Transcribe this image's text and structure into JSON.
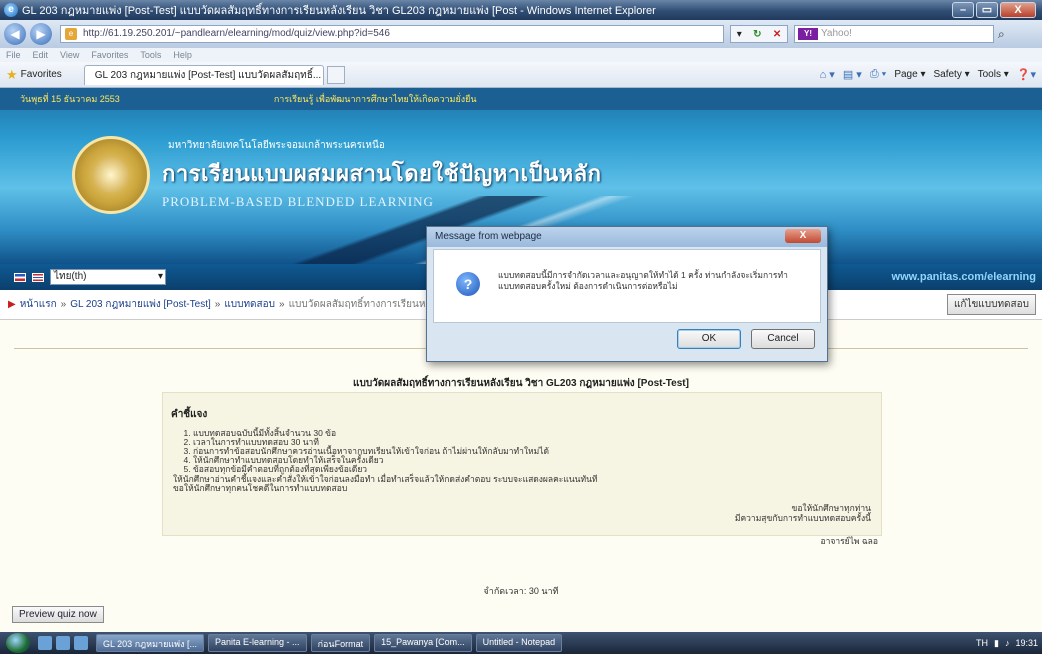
{
  "window": {
    "title": "GL 203 กฎหมายแพ่ง [Post-Test] แบบวัดผลสัมฤทธิ์ทางการเรียนหลังเรียน วิชา GL203 กฎหมายแพ่ง [Post - Windows Internet Explorer",
    "controls": [
      "–",
      "▭",
      "X"
    ]
  },
  "address": {
    "url": "http://61.19.250.201/~pandlearn/elearning/mod/quiz/view.php?id=546",
    "search_placeholder": "Yahoo!"
  },
  "menu": [
    "File",
    "Edit",
    "View",
    "Favorites",
    "Tools",
    "Help"
  ],
  "favorites": {
    "label": "Favorites",
    "tab_title": "GL 203 กฎหมายแพ่ง [Post-Test] แบบวัดผลสัมฤทธิ์...",
    "commands": [
      "Page ▾",
      "Safety ▾",
      "Tools ▾"
    ]
  },
  "banner": {
    "date": "วันพุธที่ 15 ธันวาคม 2553",
    "headline": "การเรียนรู้ เพื่อพัฒนาการศึกษาไทยให้เกิดความยั่งยืน",
    "university": "มหาวิทยาลัยเทคโนโลยีพระจอมเกล้าพระนครเหนือ",
    "thai_title": "การเรียนแบบผสมผสานโดยใช้ปัญหาเป็นหลัก",
    "eng_title": "PROBLEM-BASED BLENDED LEARNING",
    "language": "ไทย(th)",
    "site_url": "www.panitas.com/elearning"
  },
  "breadcrumb": {
    "items": [
      "หน้าแรก",
      "GL 203 กฎหมายแพ่ง [Post-Test]",
      "แบบทดสอบ"
    ],
    "current": "แบบวัดผลสัมฤทธิ์ทางการเรียนหลังเรียน",
    "update_button": "แก้ไขแบบทดสอบ"
  },
  "content": {
    "quiz_title": "แบบวัดผลสัมฤทธิ์ทางการเรียนหลังเรียน วิชา GL203 กฎหมายแพ่ง [Post-Test]",
    "instructions_heading": "คำชี้แจง",
    "instructions": [
      "แบบทดสอบฉบับนี้มีทั้งสิ้นจำนวน 30 ข้อ",
      "เวลาในการทำแบบทดสอบ 30 นาที",
      "ก่อนการทำข้อสอบนักศึกษาควรอ่านเนื้อหาจากบทเรียนให้เข้าใจก่อน ถ้าไม่ผ่านให้กลับมาทำใหม่ได้",
      "ให้นักศึกษาทำแบบทดสอบโดยทำให้เสร็จในครั้งเดียว",
      "ข้อสอบทุกข้อมีคำตอบที่ถูกต้องที่สุดเพียงข้อเดียว"
    ],
    "extra_notes": [
      "ให้นักศึกษาอ่านคำชี้แจงและคำสั่งให้เข้าใจก่อนลงมือทำ เมื่อทำเสร็จแล้วให้กดส่งคำตอบ ระบบจะแสดงผลคะแนนทันที",
      "ขอให้นักศึกษาทุกคนโชคดีในการทำแบบทดสอบ"
    ],
    "sign_line1": "ขอให้นักศึกษาทุกท่าน",
    "sign_line2": "มีความสุขกับการทำแบบทดสอบครั้งนี้",
    "teacher": "อาจารย์ไพ ฉลอ",
    "time_limit": "จำกัดเวลา: 30 นาที",
    "preview_button": "Preview quiz now"
  },
  "dialog": {
    "title": "Message from webpage",
    "message": "แบบทดสอบนี้มีการจำกัดเวลาและอนุญาตให้ทำได้ 1 ครั้ง ท่านกำลังจะเริ่มการทำแบบทดสอบครั้งใหม่ ต้องการดำเนินการต่อหรือไม่",
    "ok_label": "OK",
    "cancel_label": "Cancel"
  },
  "taskbar": {
    "buttons": [
      "GL 203 กฎหมายแพ่ง [...",
      "Panita E-learning - ...",
      "ก่อนFormat",
      "15_Pawanya [Com...",
      "Untitled - Notepad"
    ],
    "tray_lang": "TH",
    "clock": "19:31"
  }
}
